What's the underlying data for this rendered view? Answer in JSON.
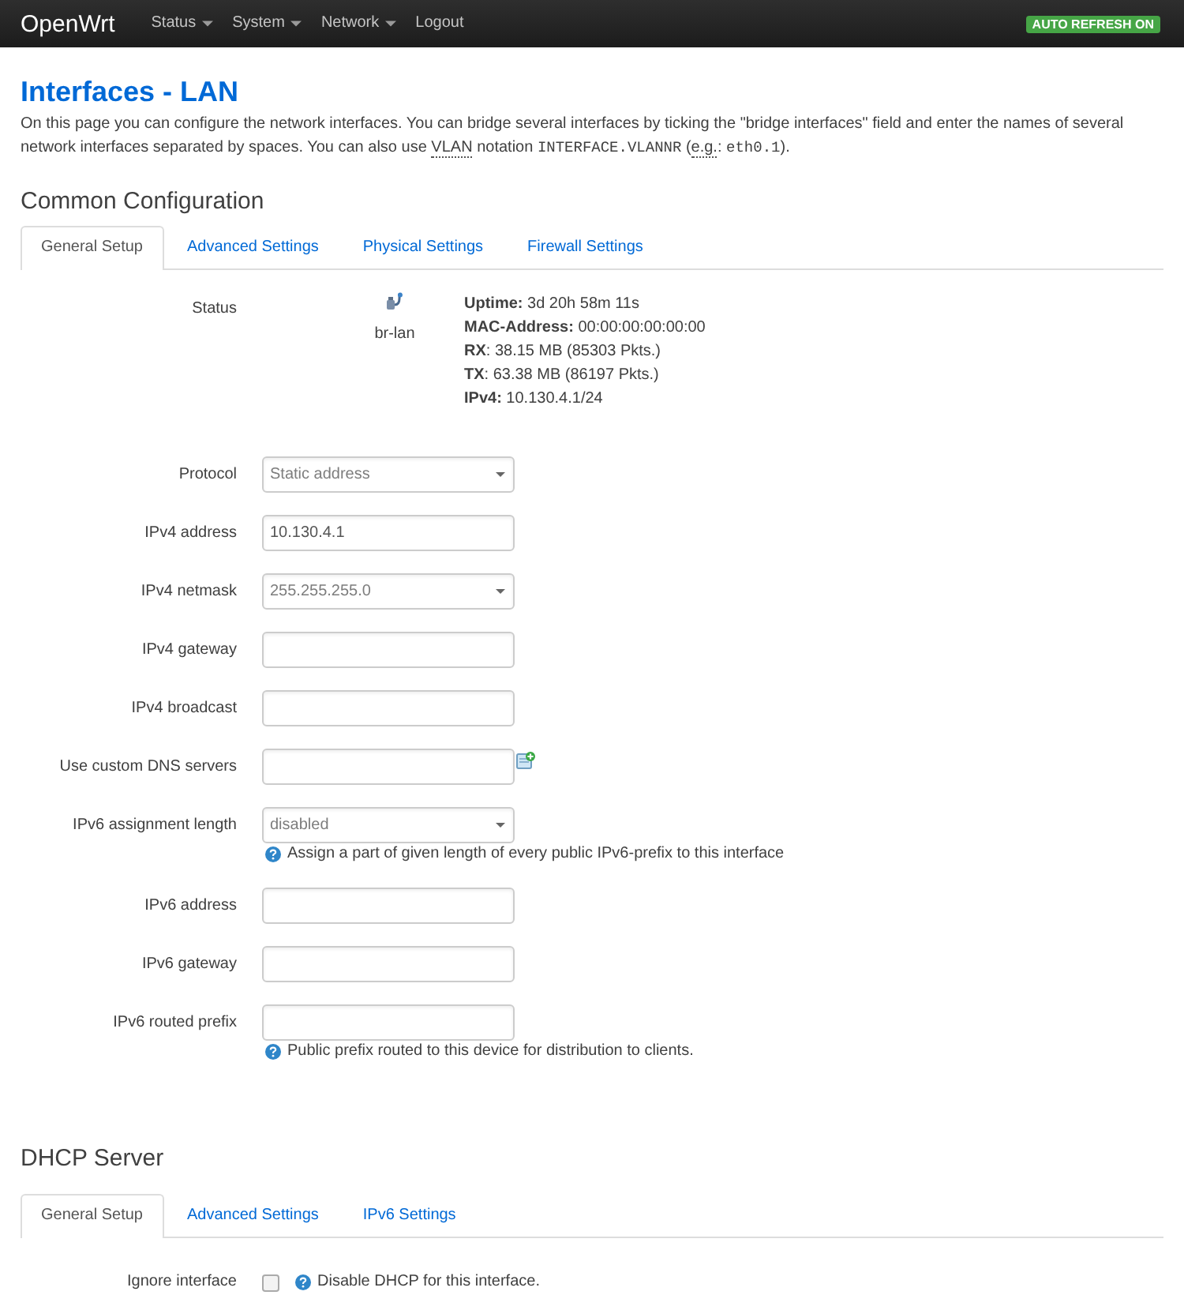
{
  "navbar": {
    "brand": "OpenWrt",
    "menu": [
      {
        "label": "Status",
        "dropdown": true
      },
      {
        "label": "System",
        "dropdown": true
      },
      {
        "label": "Network",
        "dropdown": true
      },
      {
        "label": "Logout",
        "dropdown": false
      }
    ],
    "badge": "AUTO REFRESH ON"
  },
  "page": {
    "title": "Interfaces - LAN",
    "description": [
      {
        "kind": "text",
        "text": "On this page you can configure the network interfaces. You can bridge several interfaces by ticking the \"bridge interfaces\" field and enter the names of several network interfaces separated by spaces. You can also use "
      },
      {
        "kind": "abbr",
        "text": "VLAN"
      },
      {
        "kind": "text",
        "text": " notation "
      },
      {
        "kind": "code",
        "text": "INTERFACE.VLANNR"
      },
      {
        "kind": "text",
        "text": " ("
      },
      {
        "kind": "abbr",
        "text": "e.g."
      },
      {
        "kind": "text",
        "text": ": "
      },
      {
        "kind": "code",
        "text": "eth0.1"
      },
      {
        "kind": "text",
        "text": ")."
      }
    ]
  },
  "sections": [
    {
      "title": "Common Configuration",
      "tabs": [
        {
          "label": "General Setup",
          "selected": true
        },
        {
          "label": "Advanced Settings",
          "selected": false
        },
        {
          "label": "Physical Settings",
          "selected": false
        },
        {
          "label": "Firewall Settings",
          "selected": false
        }
      ],
      "fields": [
        {
          "kind": "status",
          "label": "Status",
          "device": "br-lan",
          "lines": [
            "**Uptime:** 3d 20h 58m 11s",
            "**MAC-Address:** 00:00:00:00:00:00",
            "**RX**: 38.15 MB (85303 Pkts.)",
            "**TX**: 63.38 MB (86197 Pkts.)",
            "**IPv4:** 10.130.4.1/24"
          ]
        },
        {
          "kind": "select",
          "label": "Protocol",
          "value": "Static address"
        },
        {
          "kind": "text",
          "label": "IPv4 address",
          "value": "10.130.4.1"
        },
        {
          "kind": "select",
          "label": "IPv4 netmask",
          "value": "255.255.255.0"
        },
        {
          "kind": "text",
          "label": "IPv4 gateway"
        },
        {
          "kind": "text",
          "label": "IPv4 broadcast"
        },
        {
          "kind": "list",
          "label": "Use custom DNS servers"
        },
        {
          "kind": "select",
          "label": "IPv6 assignment length",
          "value": "disabled",
          "hint": "Assign a part of given length of every public IPv6-prefix to this interface"
        },
        {
          "kind": "text",
          "label": "IPv6 address"
        },
        {
          "kind": "text",
          "label": "IPv6 gateway"
        },
        {
          "kind": "text",
          "label": "IPv6 routed prefix",
          "hint": "Public prefix routed to this device for distribution to clients."
        }
      ]
    },
    {
      "title": "DHCP Server",
      "tabs": [
        {
          "label": "General Setup",
          "selected": true
        },
        {
          "label": "Advanced Settings",
          "selected": false
        },
        {
          "label": "IPv6 Settings",
          "selected": false
        }
      ],
      "fields": [
        {
          "kind": "checkbox",
          "label": "Ignore interface",
          "checked": false,
          "hint": "Disable DHCP for this interface."
        }
      ]
    }
  ]
}
